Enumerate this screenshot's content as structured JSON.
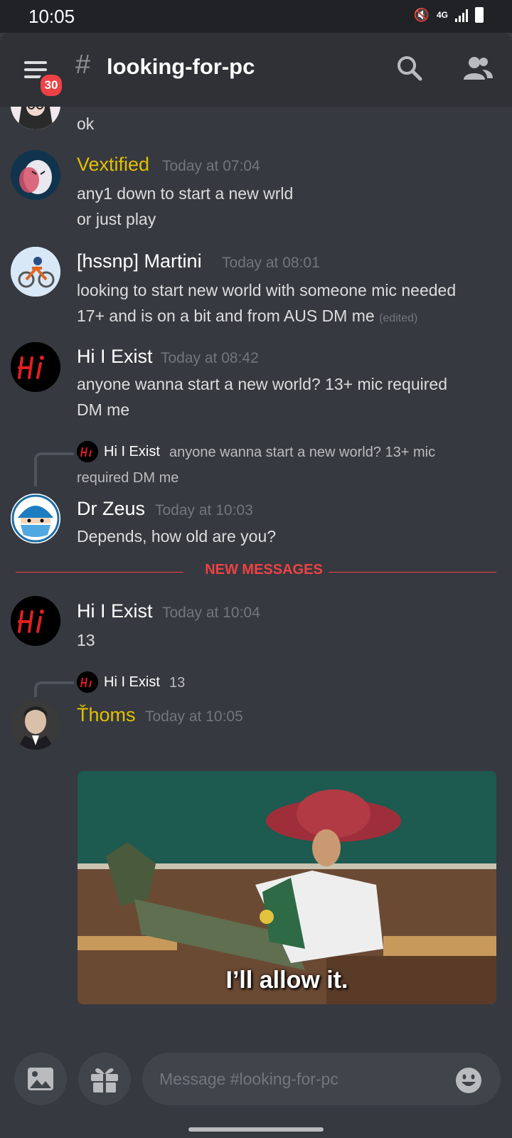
{
  "status_bar": {
    "time": "10:05",
    "network": "4G"
  },
  "header": {
    "hash": "#",
    "channel_name": "looking-for-pc",
    "unread_badge": "30"
  },
  "colors": {
    "gold_role": "#e3c000",
    "red": "#ed4245",
    "background": "#36393f"
  },
  "messages": [
    {
      "text": "ok"
    },
    {
      "author": "Vextified",
      "time": "Today at 07:04",
      "lines": [
        "any1 down to start a new wrld",
        "or just play"
      ]
    },
    {
      "author": "[hssnp] Martini",
      "time": "Today at 08:01",
      "lines": [
        "looking to start new world with someone mic needed",
        "17+ and is on a bit and from AUS DM me"
      ],
      "edited": "(edited)"
    },
    {
      "author": "Hi I Exist",
      "time": "Today at 08:42",
      "lines": [
        "anyone wanna start a new world? 13+ mic required",
        "DM me"
      ]
    },
    {
      "reply_author": "Hi I Exist",
      "reply_text_1": "anyone wanna start a new world? 13+ mic",
      "reply_text_2": "required DM me",
      "author": "Dr Zeus",
      "time": "Today at 10:03",
      "lines": [
        "Depends, how old are you?"
      ]
    },
    {
      "author": "Hi I Exist",
      "time": "Today at 10:04",
      "lines": [
        "13"
      ]
    },
    {
      "reply_author": "Hi I Exist",
      "reply_text": "13",
      "author": "Ťhoms",
      "time": "Today at 10:05",
      "gif_caption": "I’ll allow it."
    }
  ],
  "divider": {
    "label": "NEW MESSAGES"
  },
  "composer": {
    "placeholder": "Message #looking-for-pc"
  }
}
